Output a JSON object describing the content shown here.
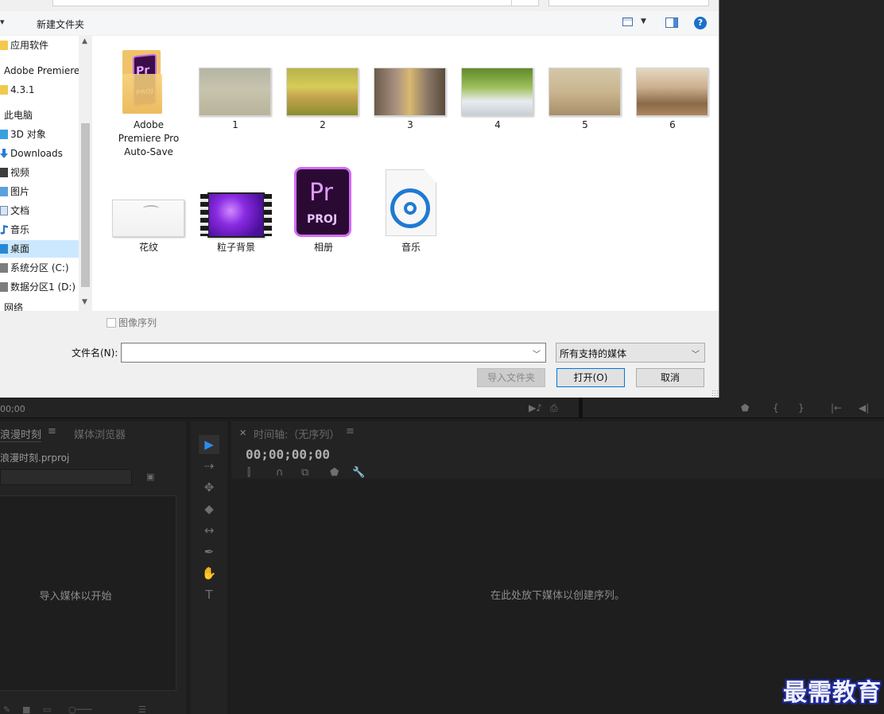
{
  "dialog": {
    "toolbar": {
      "organize_arrow": "▾",
      "new_folder": "新建文件夹",
      "help": "?"
    },
    "nav": {
      "items": [
        {
          "label": "应用软件",
          "icon": "folder-icon"
        },
        {
          "label": "Adobe Premiere",
          "icon": ""
        },
        {
          "label": "4.3.1",
          "icon": "folder-icon"
        },
        {
          "label": "此电脑",
          "icon": ""
        },
        {
          "label": "3D 对象",
          "icon": "3d-objects-icon"
        },
        {
          "label": "Downloads",
          "icon": "download-icon"
        },
        {
          "label": "视频",
          "icon": "video-icon"
        },
        {
          "label": "图片",
          "icon": "pictures-icon"
        },
        {
          "label": "文档",
          "icon": "documents-icon"
        },
        {
          "label": "音乐",
          "icon": "music-icon"
        },
        {
          "label": "桌面",
          "icon": "desktop-icon"
        },
        {
          "label": "系统分区 (C:)",
          "icon": "drive-icon"
        },
        {
          "label": "数据分区1 (D:)",
          "icon": "drive-icon"
        },
        {
          "label": "网络",
          "icon": "network-icon"
        }
      ],
      "selected": "桌面"
    },
    "files": [
      {
        "name": "Adobe Premiere Pro Auto-Save",
        "line1": "Adobe",
        "line2": "Premiere Pro",
        "line3": "Auto-Save",
        "kind": "pr-folder"
      },
      {
        "name": "1",
        "kind": "image"
      },
      {
        "name": "2",
        "kind": "image"
      },
      {
        "name": "3",
        "kind": "image"
      },
      {
        "name": "4",
        "kind": "image"
      },
      {
        "name": "5",
        "kind": "image"
      },
      {
        "name": "6",
        "kind": "image"
      },
      {
        "name": "花纹",
        "kind": "image"
      },
      {
        "name": "粒子背景",
        "kind": "video"
      },
      {
        "name": "相册",
        "kind": "prproj"
      },
      {
        "name": "音乐",
        "kind": "audio"
      }
    ],
    "icon_text": {
      "pr": "Pr",
      "proj": "PROJ"
    },
    "image_sequence_label": "图像序列",
    "filename_label": "文件名(N):",
    "filename_value": "",
    "filetype_selected": "所有支持的媒体",
    "buttons": {
      "import_folder": "导入文件夹",
      "open": "打开(O)",
      "cancel": "取消"
    }
  },
  "premiere": {
    "strip_timecode": "00;00",
    "project_panel": {
      "tab_project": "浪漫时刻",
      "tab_media_browser": "媒体浏览器",
      "file_name": "浪漫时刻.prproj",
      "empty_hint": "导入媒体以开始"
    },
    "timeline_panel": {
      "title": "时间轴:（无序列）",
      "timecode": "00;00;00;00",
      "empty_hint": "在此处放下媒体以创建序列。"
    }
  },
  "watermark": "最需教育",
  "colors": {
    "accent_blue": "#2d8ceb",
    "selection": "#cce8ff",
    "pr_purple": "#d36bf5"
  }
}
